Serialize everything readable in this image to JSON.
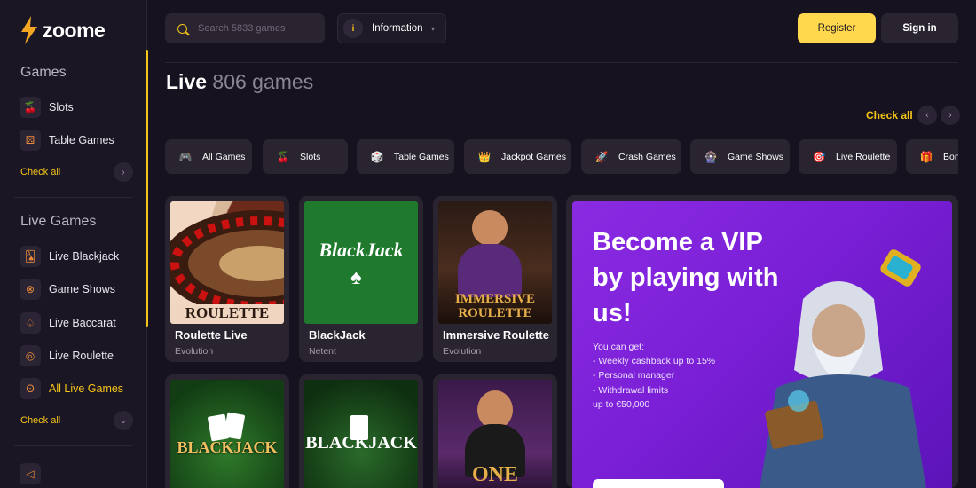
{
  "brand": {
    "name": "zoome"
  },
  "sidebar": {
    "games_title": "Games",
    "games_items": [
      {
        "label": "Slots",
        "icon": "cherry-icon"
      },
      {
        "label": "Table Games",
        "icon": "dice-icon"
      }
    ],
    "games_check_all": "Check all",
    "live_title": "Live Games",
    "live_items": [
      {
        "label": "Live Blackjack",
        "icon": "cards-icon"
      },
      {
        "label": "Game Shows",
        "icon": "wheel-icon"
      },
      {
        "label": "Live Baccarat",
        "icon": "spade-icon"
      },
      {
        "label": "Live Roulette",
        "icon": "roulette-icon"
      },
      {
        "label": "All Live Games",
        "icon": "bear-icon",
        "active": true
      }
    ],
    "live_check_all": "Check all"
  },
  "header": {
    "search_placeholder": "Search 5833 games",
    "info_label": "Information",
    "register_label": "Register",
    "signin_label": "Sign in"
  },
  "page": {
    "title": "Live",
    "count": "806 games",
    "check_all": "Check all"
  },
  "categories": [
    {
      "label": "All Games",
      "icon": "gamepad-icon"
    },
    {
      "label": "Slots",
      "icon": "cherry-icon"
    },
    {
      "label": "Table Games",
      "icon": "dice-icon"
    },
    {
      "label": "Jackpot Games",
      "icon": "crown-icon"
    },
    {
      "label": "Crash Games",
      "icon": "rocket-icon"
    },
    {
      "label": "Game Shows",
      "icon": "wheel-icon"
    },
    {
      "label": "Live Roulette",
      "icon": "roulette-icon"
    },
    {
      "label": "Bon",
      "icon": "bonus-icon"
    }
  ],
  "games": [
    {
      "name": "Roulette Live",
      "provider": "Evolution",
      "thumb_text": "ROULETTE"
    },
    {
      "name": "BlackJack",
      "provider": "Netent",
      "thumb_text": "BlackJack"
    },
    {
      "name": "Immersive Roulette",
      "provider": "Evolution",
      "thumb_text": "IMMERSIVE ROULETTE"
    },
    {
      "name": "",
      "provider": "",
      "thumb_text": "BLACKJACK"
    },
    {
      "name": "",
      "provider": "",
      "thumb_text": "BLACKJACK"
    },
    {
      "name": "",
      "provider": "",
      "thumb_text": "ONE"
    }
  ],
  "promo": {
    "headline": "Become a VIP by playing with us!",
    "perks_title": "You can get:",
    "perks": [
      "- Weekly cashback up to 15%",
      "- Personal manager",
      "- Withdrawal limits",
      "up to €50,000"
    ]
  },
  "colors": {
    "accent": "#f5c518",
    "background": "#17121f",
    "card": "#2a2431",
    "promo": "#7a1fd6"
  }
}
